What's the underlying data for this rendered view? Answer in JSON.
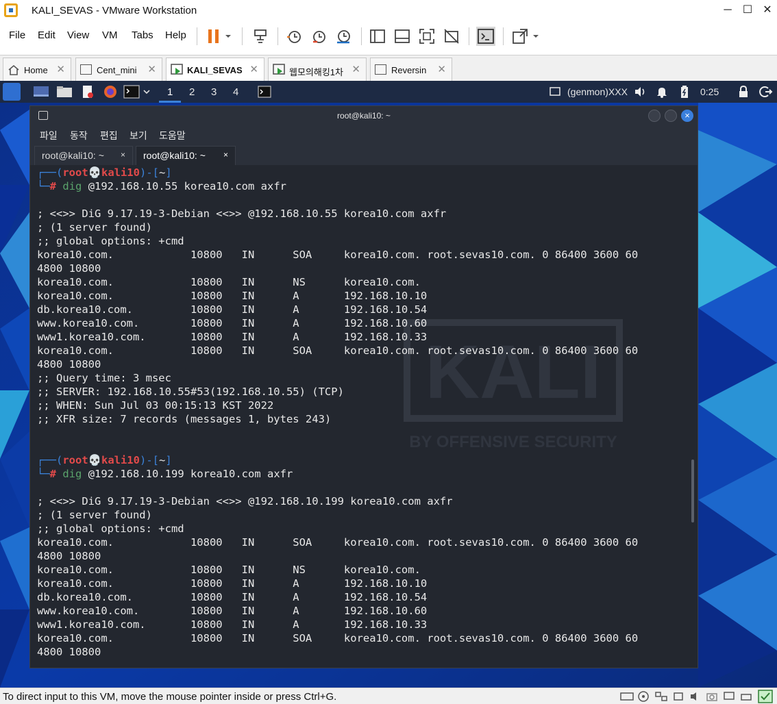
{
  "window": {
    "title": "KALI_SEVAS - VMware Workstation",
    "minimize": "─",
    "maximize": "☐",
    "close": "✕"
  },
  "menu": [
    "File",
    "Edit",
    "View",
    "VM",
    "Tabs",
    "Help"
  ],
  "tabs": [
    {
      "label": "Home",
      "active": false
    },
    {
      "label": "Cent_mini",
      "active": false
    },
    {
      "label": "KALI_SEVAS",
      "active": true
    },
    {
      "label": "웹모의해킹1차",
      "active": false
    },
    {
      "label": "Reversin",
      "active": false
    }
  ],
  "tab_close": "✕",
  "kali_panel": {
    "workspaces": [
      "1",
      "2",
      "3",
      "4"
    ],
    "genmon": "(genmon)XXX",
    "clock": "0:25"
  },
  "terminal": {
    "window_title": "root@kali10: ~",
    "menu": [
      "파일",
      "동작",
      "편집",
      "보기",
      "도움말"
    ],
    "tabs": [
      {
        "label": "root@kali10: ~",
        "active": false
      },
      {
        "label": "root@kali10: ~",
        "active": true
      }
    ],
    "tab_close": "×",
    "prompt": {
      "corner_top": "┌──",
      "open": "(",
      "user": "root",
      "skull": "💀",
      "host": "kali10",
      "close_dash": ")-[",
      "dir": "~",
      "dir_close": "]",
      "corner_bottom": "└─",
      "hash": "#"
    },
    "sessions": [
      {
        "command_name": "dig",
        "command_args": " @192.168.10.55 korea10.com axfr",
        "output": [
          "; <<>> DiG 9.17.19-3-Debian <<>> @192.168.10.55 korea10.com axfr",
          "; (1 server found)",
          ";; global options: +cmd",
          "korea10.com.            10800   IN      SOA     korea10.com. root.sevas10.com. 0 86400 3600 60",
          "4800 10800",
          "korea10.com.            10800   IN      NS      korea10.com.",
          "korea10.com.            10800   IN      A       192.168.10.10",
          "db.korea10.com.         10800   IN      A       192.168.10.54",
          "www.korea10.com.        10800   IN      A       192.168.10.60",
          "www1.korea10.com.       10800   IN      A       192.168.10.33",
          "korea10.com.            10800   IN      SOA     korea10.com. root.sevas10.com. 0 86400 3600 60",
          "4800 10800",
          ";; Query time: 3 msec",
          ";; SERVER: 192.168.10.55#53(192.168.10.55) (TCP)",
          ";; WHEN: Sun Jul 03 00:15:13 KST 2022",
          ";; XFR size: 7 records (messages 1, bytes 243)"
        ]
      },
      {
        "command_name": "dig",
        "command_args": " @192.168.10.199 korea10.com axfr",
        "output": [
          "; <<>> DiG 9.17.19-3-Debian <<>> @192.168.10.199 korea10.com axfr",
          "; (1 server found)",
          ";; global options: +cmd",
          "korea10.com.            10800   IN      SOA     korea10.com. root.sevas10.com. 0 86400 3600 60",
          "4800 10800",
          "korea10.com.            10800   IN      NS      korea10.com.",
          "korea10.com.            10800   IN      A       192.168.10.10",
          "db.korea10.com.         10800   IN      A       192.168.10.54",
          "www.korea10.com.        10800   IN      A       192.168.10.60",
          "www1.korea10.com.       10800   IN      A       192.168.10.33",
          "korea10.com.            10800   IN      SOA     korea10.com. root.sevas10.com. 0 86400 3600 60",
          "4800 10800"
        ]
      }
    ]
  },
  "desktop": {
    "watermark_logo": "KALI",
    "watermark_sub": "BY OFFENSIVE SECURITY"
  },
  "statusbar": {
    "message": "To direct input to this VM, move the mouse pointer inside or press Ctrl+G."
  }
}
